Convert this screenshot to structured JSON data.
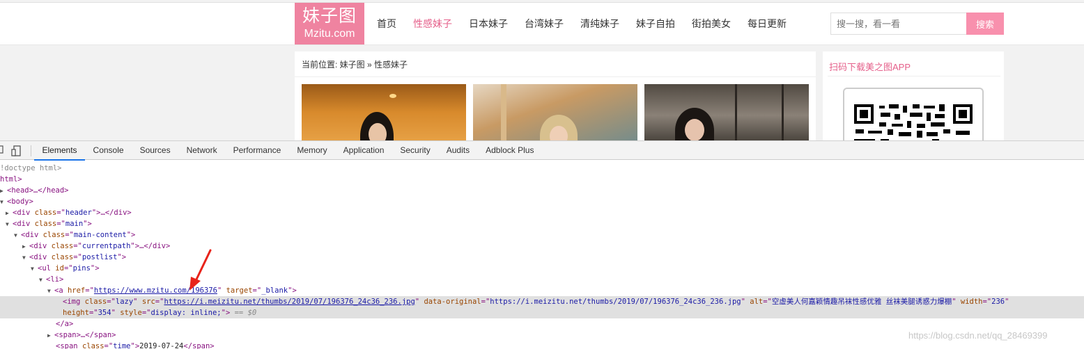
{
  "site": {
    "logo_line1": "妹子图",
    "logo_line2": "Mzitu.com",
    "nav": [
      {
        "label": "首页",
        "active": false
      },
      {
        "label": "性感妹子",
        "active": true
      },
      {
        "label": "日本妹子",
        "active": false
      },
      {
        "label": "台湾妹子",
        "active": false
      },
      {
        "label": "清纯妹子",
        "active": false
      },
      {
        "label": "妹子自拍",
        "active": false
      },
      {
        "label": "街拍美女",
        "active": false
      },
      {
        "label": "每日更新",
        "active": false
      }
    ],
    "search_placeholder": "搜一搜，看一看",
    "search_button": "搜索",
    "breadcrumb": "当前位置: 妹子图 » 性感妹子",
    "sidebar_title": "扫码下载美之图APP",
    "colors": {
      "brand": "#ef83a0",
      "nav_active": "#e55f8a",
      "search_button": "#f890ad"
    }
  },
  "devtools": {
    "tabs": [
      "Elements",
      "Console",
      "Sources",
      "Network",
      "Performance",
      "Memory",
      "Application",
      "Security",
      "Audits",
      "Adblock Plus"
    ],
    "active_tab": "Elements",
    "icons": [
      "inspect-cursor-icon",
      "device-toggle-icon"
    ],
    "dom": {
      "doctype": "!doctype html>",
      "html": "html>",
      "head": "<head>…</head>",
      "body": "<body>",
      "header_class": "header",
      "main_class": "main",
      "main_content_class": "main-content",
      "currentpath_class": "currentpath",
      "postlist_class": "postlist",
      "ul_id": "pins",
      "a_href": "https://www.mzitu.com/196376",
      "a_target": "_blank",
      "img_class": "lazy",
      "img_src": "https://i.meizitu.net/thumbs/2019/07/196376_24c36_236.jpg",
      "img_data_original": "https://i.meizitu.net/thumbs/2019/07/196376_24c36_236.jpg",
      "img_alt": "空虚美人何嘉颖情趣吊袜性感优雅 丝袜美腿诱惑力爆棚",
      "img_width": "236",
      "img_height": "354",
      "img_style": "display: inline;",
      "console_ref": "== $0",
      "span_collapsed": "<span>…</span>",
      "time_class": "time",
      "time_value": "2019-07-24"
    }
  },
  "watermark": "https://blog.csdn.net/qq_28469399"
}
